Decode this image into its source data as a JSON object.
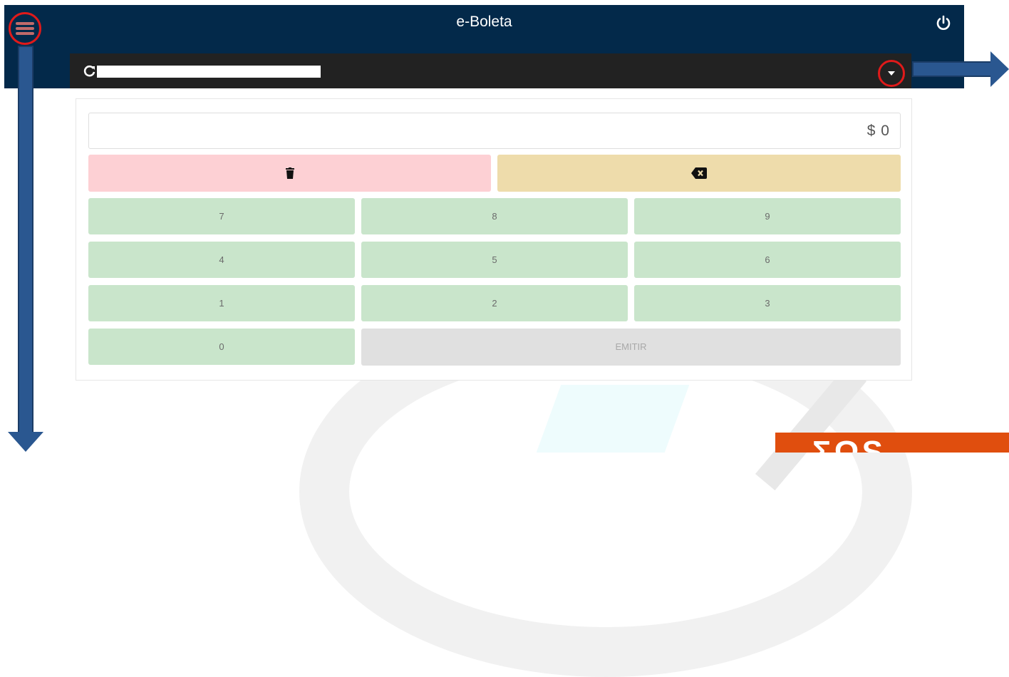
{
  "header": {
    "title": "e-Boleta"
  },
  "device_bar": {
    "device_name": ""
  },
  "amount": {
    "display": "$ 0"
  },
  "keypad": {
    "rows": [
      [
        "7",
        "8",
        "9"
      ],
      [
        "4",
        "5",
        "6"
      ],
      [
        "1",
        "2",
        "3"
      ]
    ],
    "zero": "0",
    "emit_label": "EMITIR"
  },
  "icons": {
    "menu": "hamburger-menu-icon",
    "power": "power-icon",
    "refresh": "refresh-icon",
    "dropdown": "caret-down-icon",
    "clear": "trash-icon",
    "backspace": "backspace-icon"
  },
  "colors": {
    "header_bg": "#03294a",
    "subbar_bg": "#222222",
    "clear_bg": "#fdd0d4",
    "backspace_bg": "#eedcab",
    "key_bg": "#c9e5cb",
    "emit_bg": "#e0e0e0",
    "annotation_circle": "#e01a1a",
    "annotation_arrow": "#2a5790"
  }
}
